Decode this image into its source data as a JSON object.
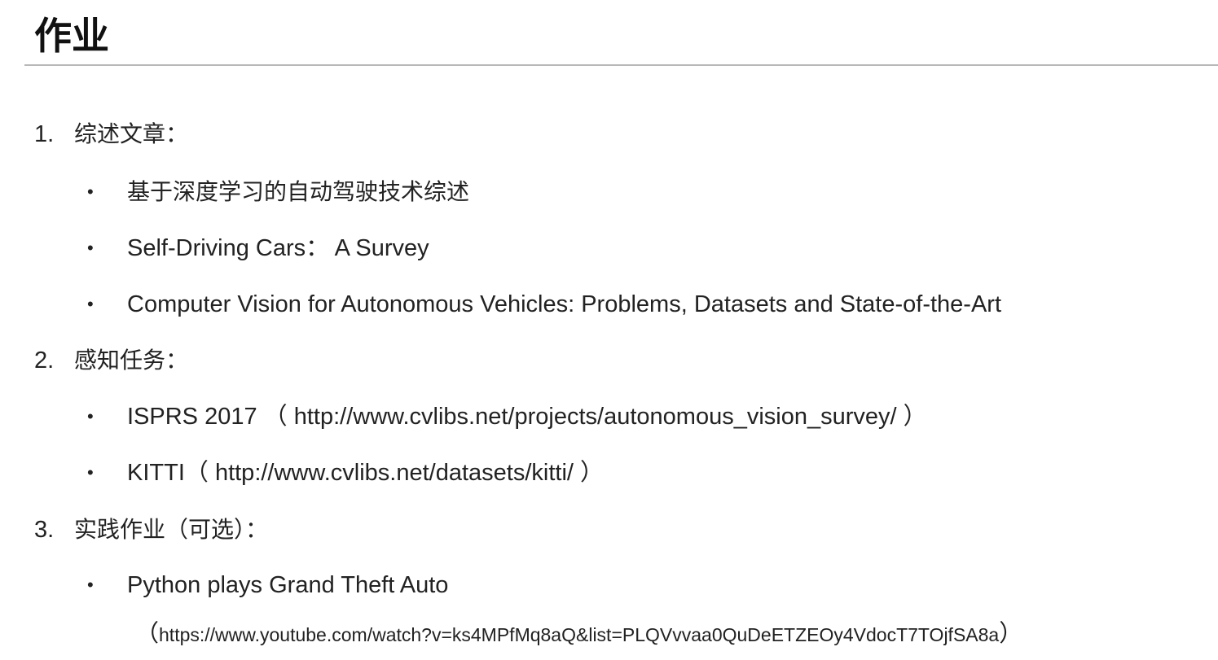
{
  "title": "作业",
  "sections": [
    {
      "number": "1.",
      "heading": "综述文章：",
      "items": [
        "基于深度学习的自动驾驶技术综述",
        "Self-Driving Cars： A Survey",
        "Computer Vision for Autonomous Vehicles: Problems, Datasets and State-of-the-Art"
      ]
    },
    {
      "number": "2.",
      "heading": "感知任务：",
      "items": [
        "ISPRS 2017 （ http://www.cvlibs.net/projects/autonomous_vision_survey/ ）",
        "KITTI（  http://www.cvlibs.net/datasets/kitti/  ）"
      ]
    },
    {
      "number": "3.",
      "heading": "实践作业（可选）：",
      "items": [
        "Python plays Grand Theft Auto"
      ],
      "link": {
        "open": "（",
        "url": "https://www.youtube.com/watch?v=ks4MPfMq8aQ&list=PLQVvvaa0QuDeETZEOy4VdocT7TOjfSA8a",
        "close": "）"
      }
    }
  ],
  "bullet_symbol": "•"
}
